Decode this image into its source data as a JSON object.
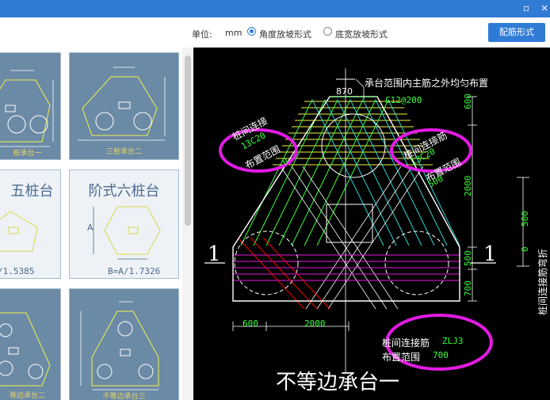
{
  "window": {
    "minimize_glyph": "▫",
    "close_glyph": "×"
  },
  "toolbar": {
    "unit_label": "单位:",
    "unit_value": "mm",
    "radio_angle": "角度放坡形式",
    "radio_width": "底宽放坡形式",
    "selected": "角度放坡形式",
    "config_button": "配筋形式"
  },
  "thumbnails": [
    {
      "caption": "三桩承台一",
      "partial_caption": "桩承台一"
    },
    {
      "caption": "三桩承台二"
    },
    {
      "title": "五桩台",
      "formula": "/1.5385"
    },
    {
      "title": "阶式六桩台",
      "formula": "B=A/1.7326",
      "axis": "A"
    },
    {
      "caption": "不等边承台二",
      "partial_caption": "等边承台二"
    },
    {
      "caption": "不等边承台三"
    }
  ],
  "drawing": {
    "colors": {
      "cut_line": "#ff0000",
      "highlight": "#e21be2",
      "yellow": "#f2f24a",
      "green": "#3cff3c",
      "cyan": "#28d6d6"
    },
    "top_note": "承台范围内主筋之外均匀布置",
    "dim_top": "870",
    "rebar_top": "C12@200",
    "left_label_1": "桩间连接",
    "left_value": "13C20",
    "left_label_2": "布置范围",
    "left_value_2": "0",
    "right_label_1": "桩间连接筋",
    "right_value": "13C20",
    "right_label_2": "布置范围",
    "right_value_2": "500",
    "dim_right_1": "600",
    "dim_right_2": "2000",
    "dim_right_3": "500",
    "dim_right_4": "700",
    "dim_bottom_1": "600",
    "dim_bottom_2": "2000",
    "section_mark_left": "1",
    "section_mark_right": "1",
    "bottom_label_1": "桩间连接筋",
    "bottom_value_1": "ZLJ3",
    "bottom_label_2": "布置范围",
    "bottom_value_2": "700",
    "main_title": "不等边承台一",
    "side_dim_1": "500",
    "side_dim_2": "0",
    "side_label": "桩间连接筋弯折"
  }
}
